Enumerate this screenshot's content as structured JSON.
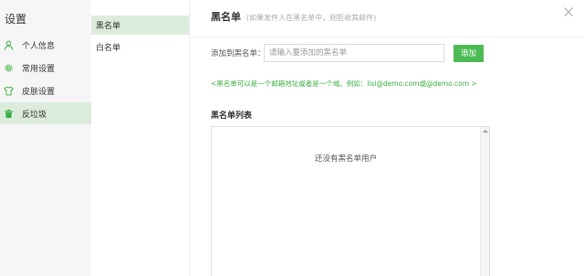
{
  "settings": {
    "title": "设置",
    "items": [
      {
        "label": "个人信息",
        "icon": "person-icon"
      },
      {
        "label": "常用设置",
        "icon": "gear-icon"
      },
      {
        "label": "皮肤设置",
        "icon": "shirt-icon"
      },
      {
        "label": "反垃圾",
        "icon": "trash-icon"
      }
    ],
    "active_index": 3
  },
  "submenu": {
    "items": [
      "黑名单",
      "白名单"
    ],
    "active_index": 0
  },
  "blacklist": {
    "title": "黑名单",
    "description": "(如果发件人在黑名单中，则拒收其邮件)",
    "add_label": "添加到黑名单：",
    "input_value": "",
    "input_placeholder": "请输入要添加的黑名单",
    "add_button": "添加",
    "hint": "<黑名单可以是一个邮箱地址或者是一个域。例如：lisi@demo.com或@demo.com >",
    "list_title": "黑名单列表",
    "empty_text": "还没有黑名单用户"
  },
  "colors": {
    "accent": "#4dbb55",
    "hint": "#3cb043",
    "active_bg": "#dcecdc",
    "sidebar_bg": "#f6f6f6"
  }
}
